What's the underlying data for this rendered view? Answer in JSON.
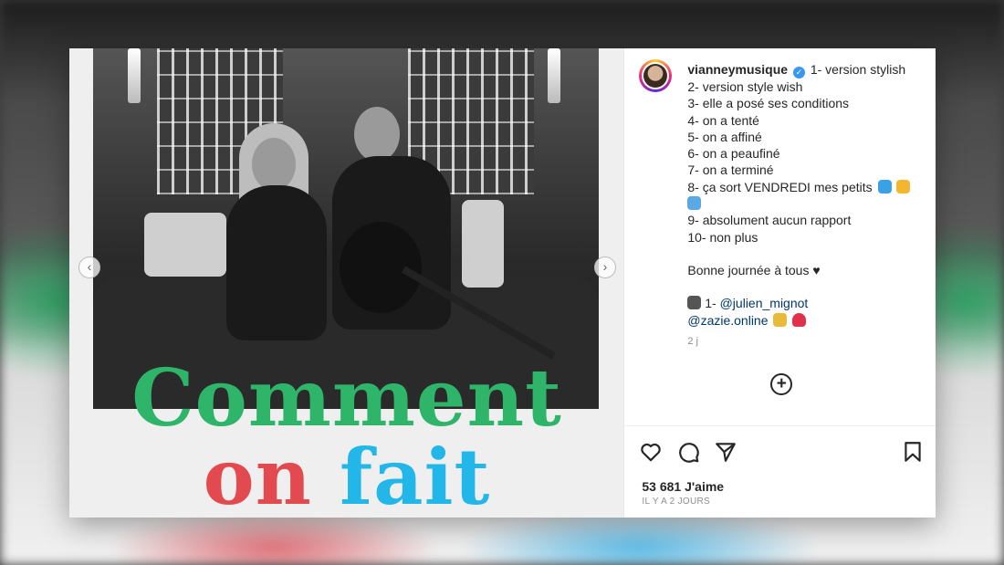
{
  "post": {
    "headline_line1": "Comment",
    "headline_word_on": "on",
    "headline_word_fait": "fait",
    "nav_prev": "‹",
    "nav_next": "›"
  },
  "caption": {
    "username": "vianneymusique",
    "verified_glyph": "✓",
    "lines": [
      "1- version stylish",
      "2- version style wish",
      "3- elle a posé ses conditions",
      "4- on a tenté",
      "5- on a affiné",
      "6- on a peaufiné",
      "7- on a terminé",
      "8- ça sort VENDREDI mes petits",
      "9- absolument aucun rapport",
      "10- non plus",
      "Bonne journée à tous ♥",
      "1-",
      "@julien_mignot",
      "@zazie.online"
    ],
    "time": "2 j",
    "add_comment_icon": "+"
  },
  "actions": {
    "icons": [
      "heart-icon",
      "comment-icon",
      "share-icon",
      "bookmark-icon"
    ],
    "likes": "53 681 J'aime",
    "posted_ago": "IL Y A 2 JOURS"
  },
  "colors": {
    "green": "#2eb56a",
    "red": "#e34a50",
    "blue": "#22b7e8",
    "verified": "#3897f0",
    "mention": "#00376b"
  }
}
